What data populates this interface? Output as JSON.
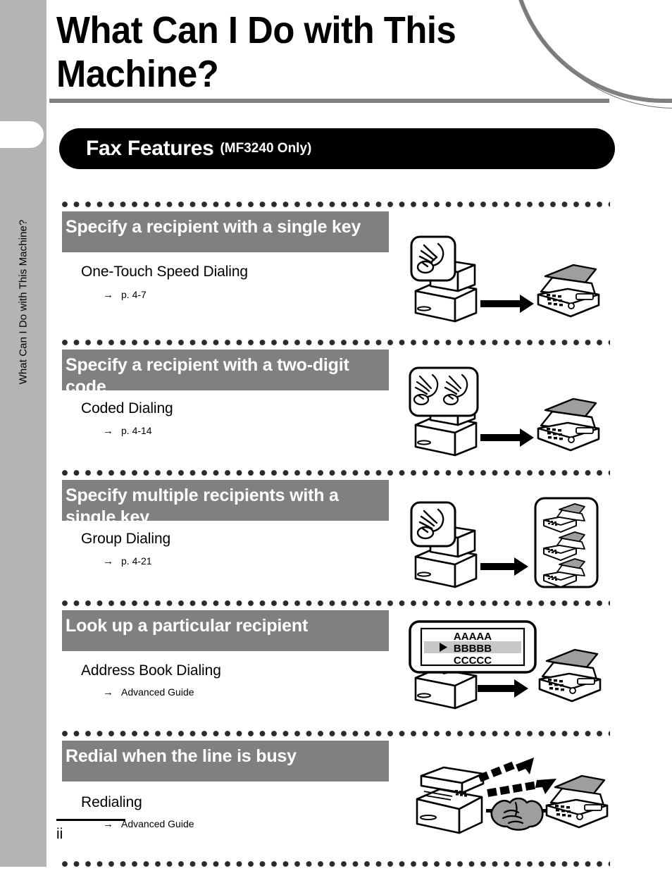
{
  "side_tab": {
    "label": "What Can I Do with This Machine?"
  },
  "page_title": "What Can I Do with This Machine?",
  "banner": {
    "title": "Fax Features",
    "subtitle": "(MF3240 Only)"
  },
  "sections": [
    {
      "heading": "Specify a recipient with a single key",
      "subtitle": "One-Touch Speed Dialing",
      "reference_arrow": "→",
      "reference": "p. 4-7",
      "illustration": "printer-hand-press-to-fax"
    },
    {
      "heading": "Specify a recipient with a two-digit code",
      "subtitle": "Coded Dialing",
      "reference_arrow": "→",
      "reference": "p. 4-14",
      "illustration": "printer-two-hands-press-to-fax"
    },
    {
      "heading": "Specify multiple recipients with a single key",
      "subtitle": "Group Dialing",
      "reference_arrow": "→",
      "reference": "p. 4-21",
      "illustration": "printer-hand-press-to-three-faxes"
    },
    {
      "heading": "Look up a particular recipient",
      "subtitle": "Address Book Dialing",
      "reference_arrow": "→",
      "reference": "Advanced Guide",
      "illustration": "lcd-address-book-to-fax",
      "lcd_lines": [
        "AAAAA",
        "BBBBB",
        "CCCCC"
      ],
      "lcd_selected_index": 1,
      "lcd_cursor": "▶"
    },
    {
      "heading": "Redial when the line is busy",
      "subtitle": "Redialing",
      "reference_arrow": "→",
      "reference": "Advanced Guide",
      "illustration": "printer-handshake-fax-dashed-arrows"
    }
  ],
  "footer": {
    "page_number": "ii"
  },
  "colors": {
    "heading_bar": "#808080",
    "side_tab": "#b4b4b4",
    "banner": "#000000",
    "rule": "#808080",
    "dot": "#2b2b2b",
    "lcd_highlight": "#c8c8c8",
    "paper_gray": "#9e9e9e"
  }
}
